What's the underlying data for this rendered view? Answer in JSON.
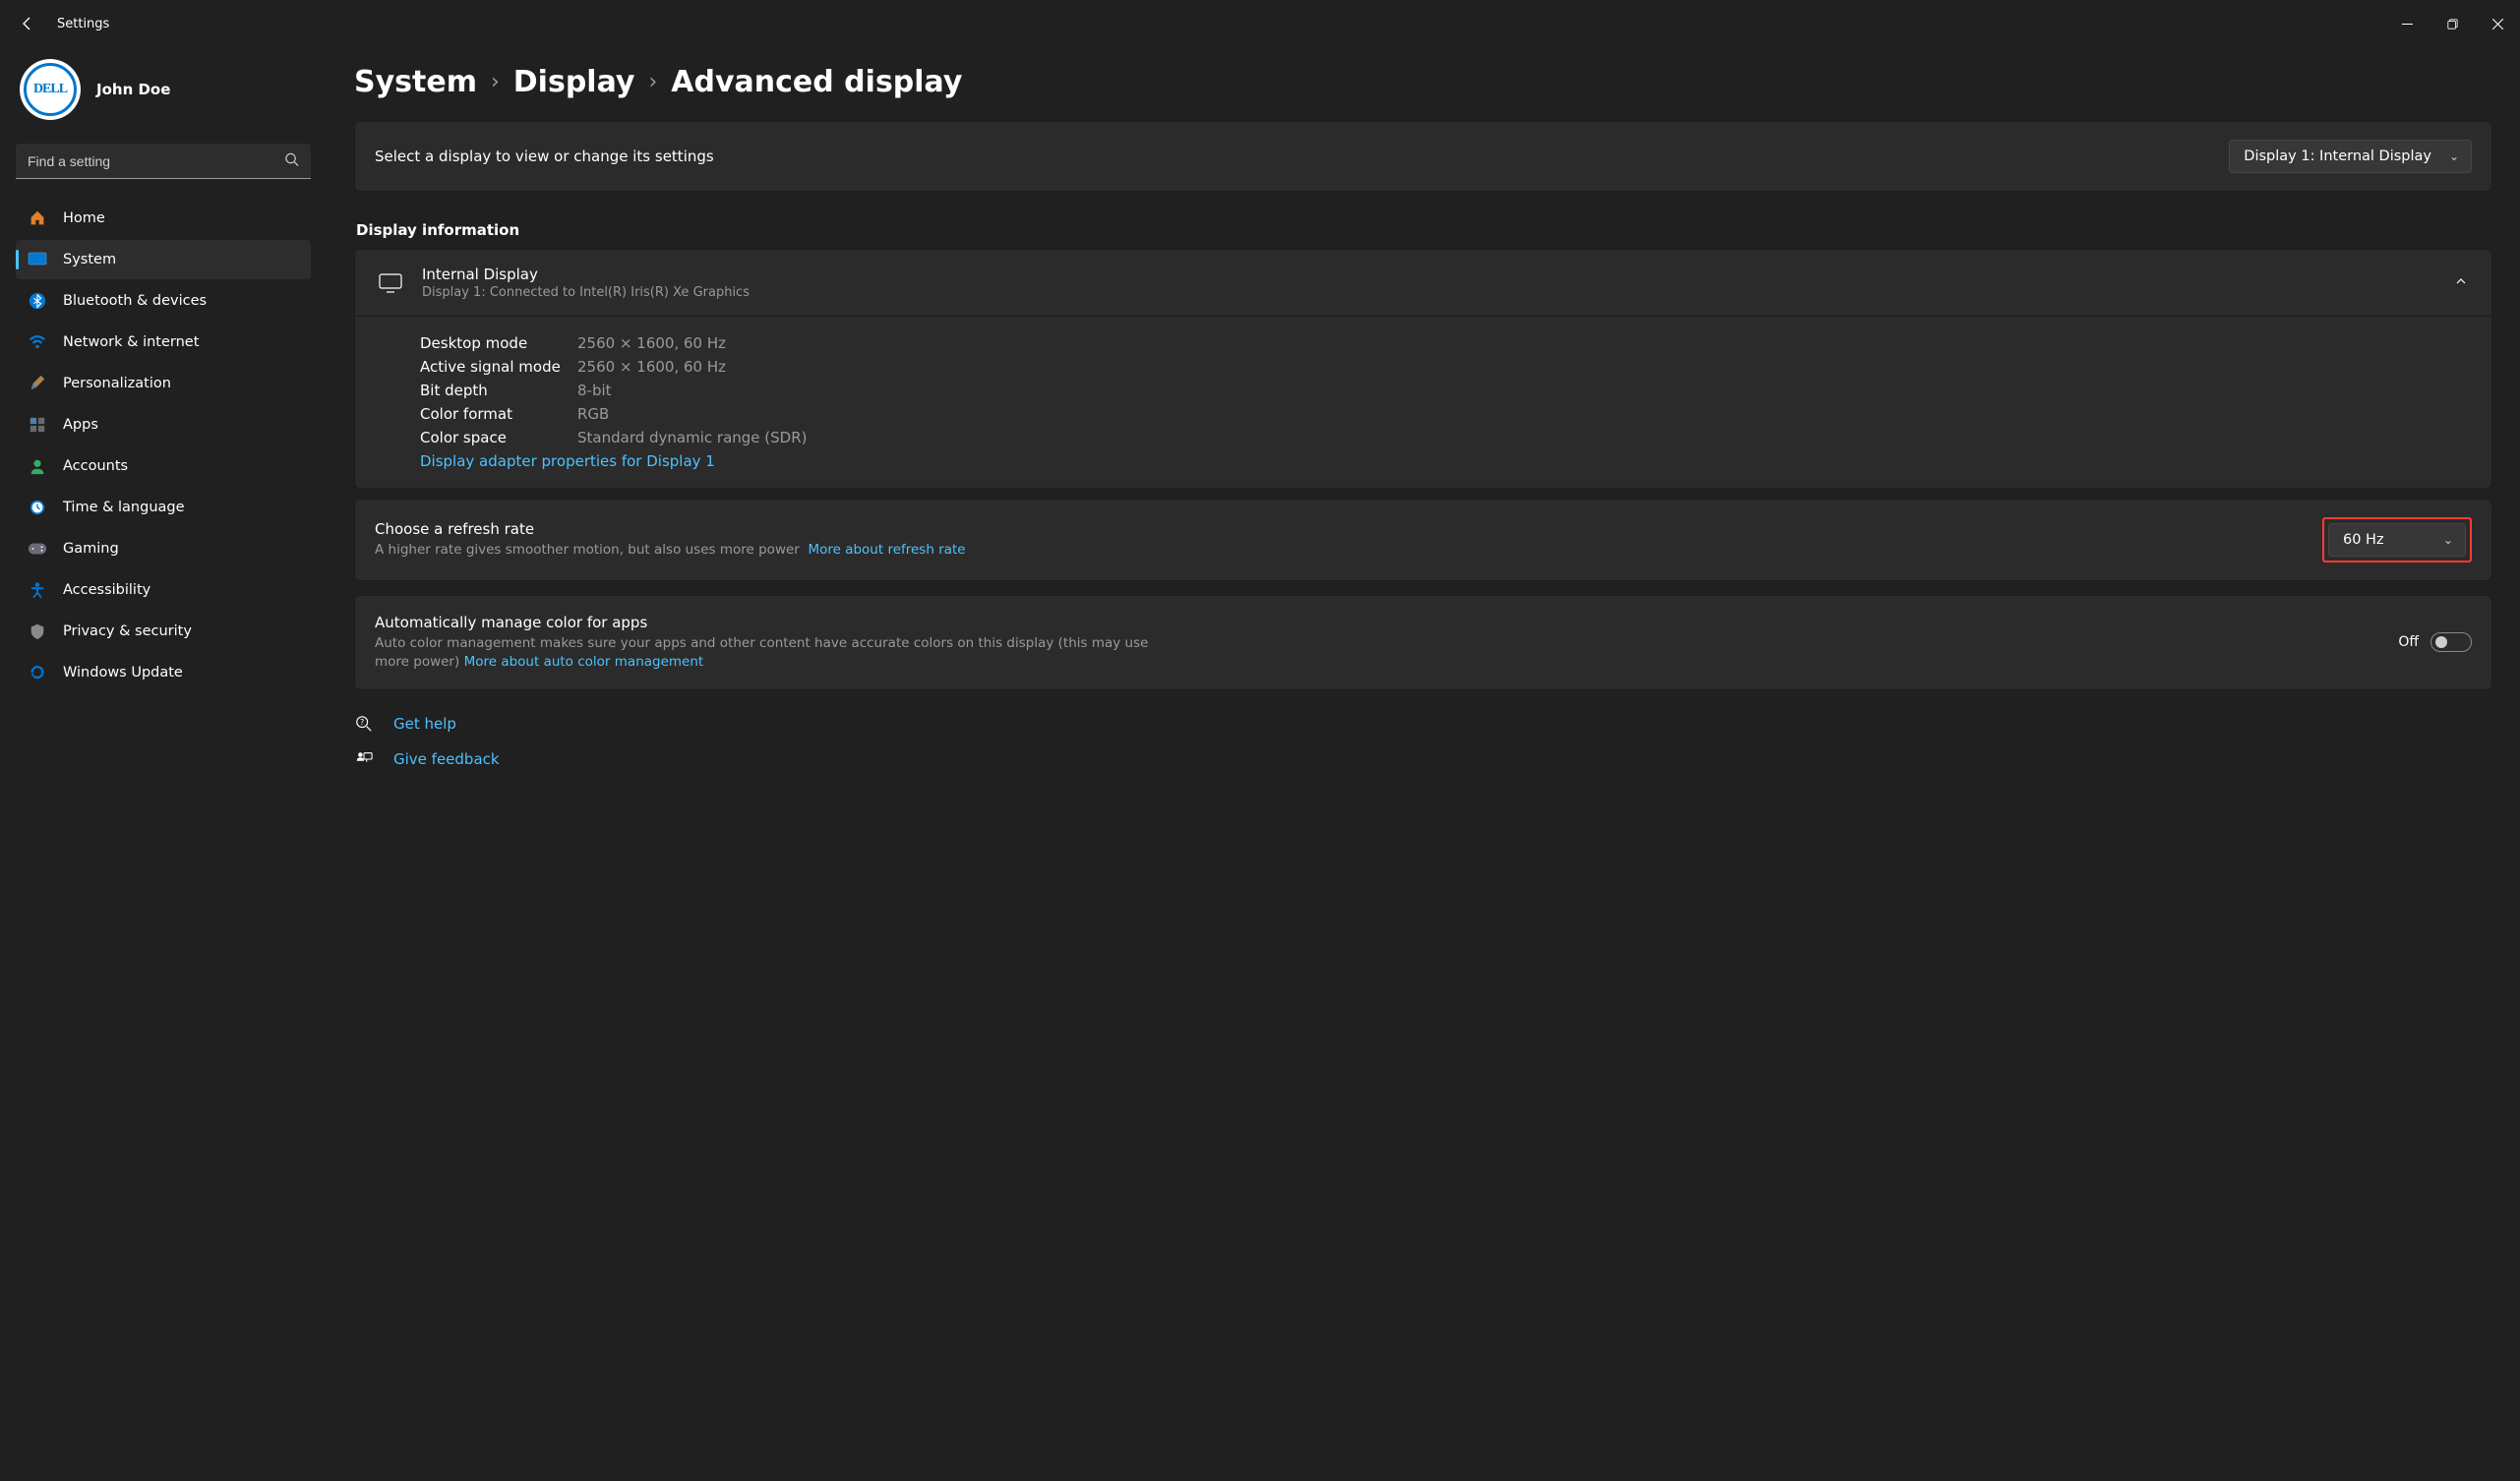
{
  "window": {
    "title": "Settings"
  },
  "user": {
    "name": "John Doe",
    "avatar_text": "DELL"
  },
  "search": {
    "placeholder": "Find a setting"
  },
  "nav": [
    {
      "key": "home",
      "label": "Home"
    },
    {
      "key": "system",
      "label": "System",
      "active": true
    },
    {
      "key": "bluetooth",
      "label": "Bluetooth & devices"
    },
    {
      "key": "network",
      "label": "Network & internet"
    },
    {
      "key": "personalization",
      "label": "Personalization"
    },
    {
      "key": "apps",
      "label": "Apps"
    },
    {
      "key": "accounts",
      "label": "Accounts"
    },
    {
      "key": "time",
      "label": "Time & language"
    },
    {
      "key": "gaming",
      "label": "Gaming"
    },
    {
      "key": "accessibility",
      "label": "Accessibility"
    },
    {
      "key": "privacy",
      "label": "Privacy & security"
    },
    {
      "key": "update",
      "label": "Windows Update"
    }
  ],
  "breadcrumb": {
    "a": "System",
    "b": "Display",
    "c": "Advanced display"
  },
  "select_display": {
    "prompt": "Select a display to view or change its settings",
    "value": "Display 1: Internal Display"
  },
  "section_info_title": "Display information",
  "display": {
    "title": "Internal Display",
    "sub": "Display 1: Connected to Intel(R) Iris(R) Xe Graphics",
    "rows": [
      {
        "label": "Desktop mode",
        "value": "2560 × 1600, 60 Hz"
      },
      {
        "label": "Active signal mode",
        "value": "2560 × 1600, 60 Hz"
      },
      {
        "label": "Bit depth",
        "value": "8-bit"
      },
      {
        "label": "Color format",
        "value": "RGB"
      },
      {
        "label": "Color space",
        "value": "Standard dynamic range (SDR)"
      }
    ],
    "adapter_link": "Display adapter properties for Display 1"
  },
  "refresh": {
    "title": "Choose a refresh rate",
    "sub": "A higher rate gives smoother motion, but also uses more power",
    "more_link": "More about refresh rate",
    "value": "60 Hz"
  },
  "auto_color": {
    "title": "Automatically manage color for apps",
    "sub": "Auto color management makes sure your apps and other content have accurate colors on this display (this may use more power)",
    "more_link": "More about auto color management",
    "state_label": "Off"
  },
  "footer": {
    "help": "Get help",
    "feedback": "Give feedback"
  }
}
